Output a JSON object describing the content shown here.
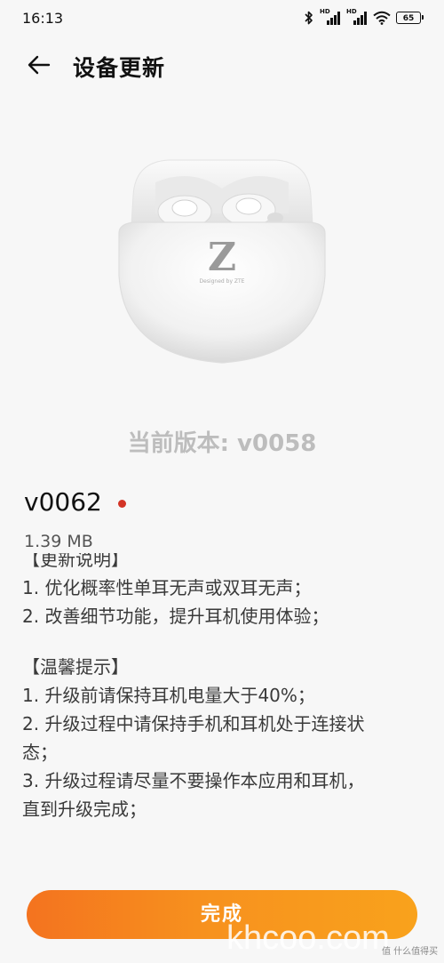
{
  "status_bar": {
    "time": "16:13",
    "signal1_label": "HD",
    "signal2_label": "HD",
    "battery": "65"
  },
  "header": {
    "title": "设备更新"
  },
  "product": {
    "image_icon": "earbuds-case-image",
    "logo_letter": "Z",
    "logo_text": "Designed by ZTE"
  },
  "version": {
    "current": "当前版本: v0058",
    "new": "v0062",
    "size": "1.39 MB",
    "new_dot_color": "#d33426"
  },
  "notes": {
    "section1_title": "【更新说明】",
    "section1_items": [
      "1. 优化概率性单耳无声或双耳无声；",
      "2. 改善细节功能，提升耳机使用体验；"
    ],
    "section2_title": "【温馨提示】",
    "section2_items": [
      "1. 升级前请保持耳机电量大于40%；",
      "2. 升级过程中请保持手机和耳机处于连接状",
      "态；",
      "3. 升级过程请尽量不要操作本应用和耳机，",
      "直到升级完成；"
    ]
  },
  "actions": {
    "done_label": "完成",
    "button_color": "#f7911e"
  },
  "watermark": {
    "site": "khcoo.com",
    "small": "值 什么值得买"
  }
}
